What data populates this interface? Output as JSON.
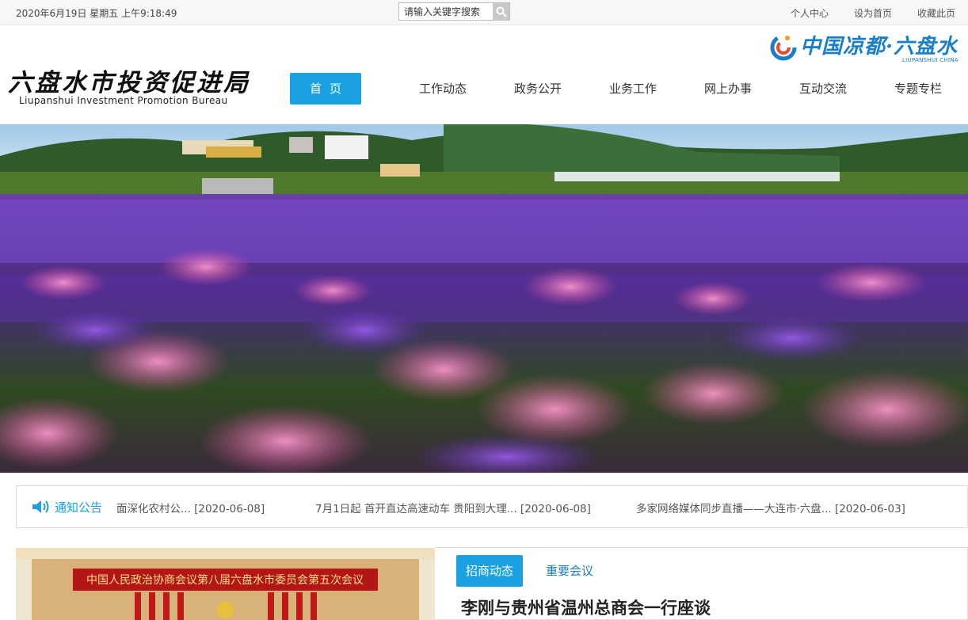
{
  "topbar": {
    "datetime": "2020年6月19日 星期五 上午9:18:49",
    "search_placeholder": "请输入关键字搜索",
    "links": [
      "个人中心",
      "设为首页",
      "收藏此页"
    ]
  },
  "header": {
    "logo_cn": "六盘水市投资促进局",
    "logo_en": "Liupanshui Investment Promotion Bureau",
    "brand_cn": "中国凉都·六盘水",
    "brand_en": "LIUPANSHUI CHINA"
  },
  "nav": {
    "items": [
      "首页",
      "工作动态",
      "政务公开",
      "业务工作",
      "网上办事",
      "互动交流",
      "专题专栏"
    ],
    "active_index": 0
  },
  "notice": {
    "title": "通知公告",
    "items": [
      "面深化农村公... [2020-06-08]",
      "7月1日起 首开直达高速动车 贵阳到大理... [2020-06-08]",
      "多家网络媒体同步直播——大连市·六盘... [2020-06-03]"
    ]
  },
  "news": {
    "photo_banner_text": "中国人民政治协商会议第八届六盘水市委员会第五次会议",
    "tabs": [
      "招商动态",
      "重要会议"
    ],
    "active_tab": 0,
    "headline": "李刚与贵州省温州总商会一行座谈"
  },
  "colors": {
    "accent": "#1ba1e2",
    "link_blue": "#1b7ec1",
    "text": "#333333"
  },
  "icons": [
    "search-icon",
    "speaker-icon",
    "brand-swirl-icon"
  ]
}
